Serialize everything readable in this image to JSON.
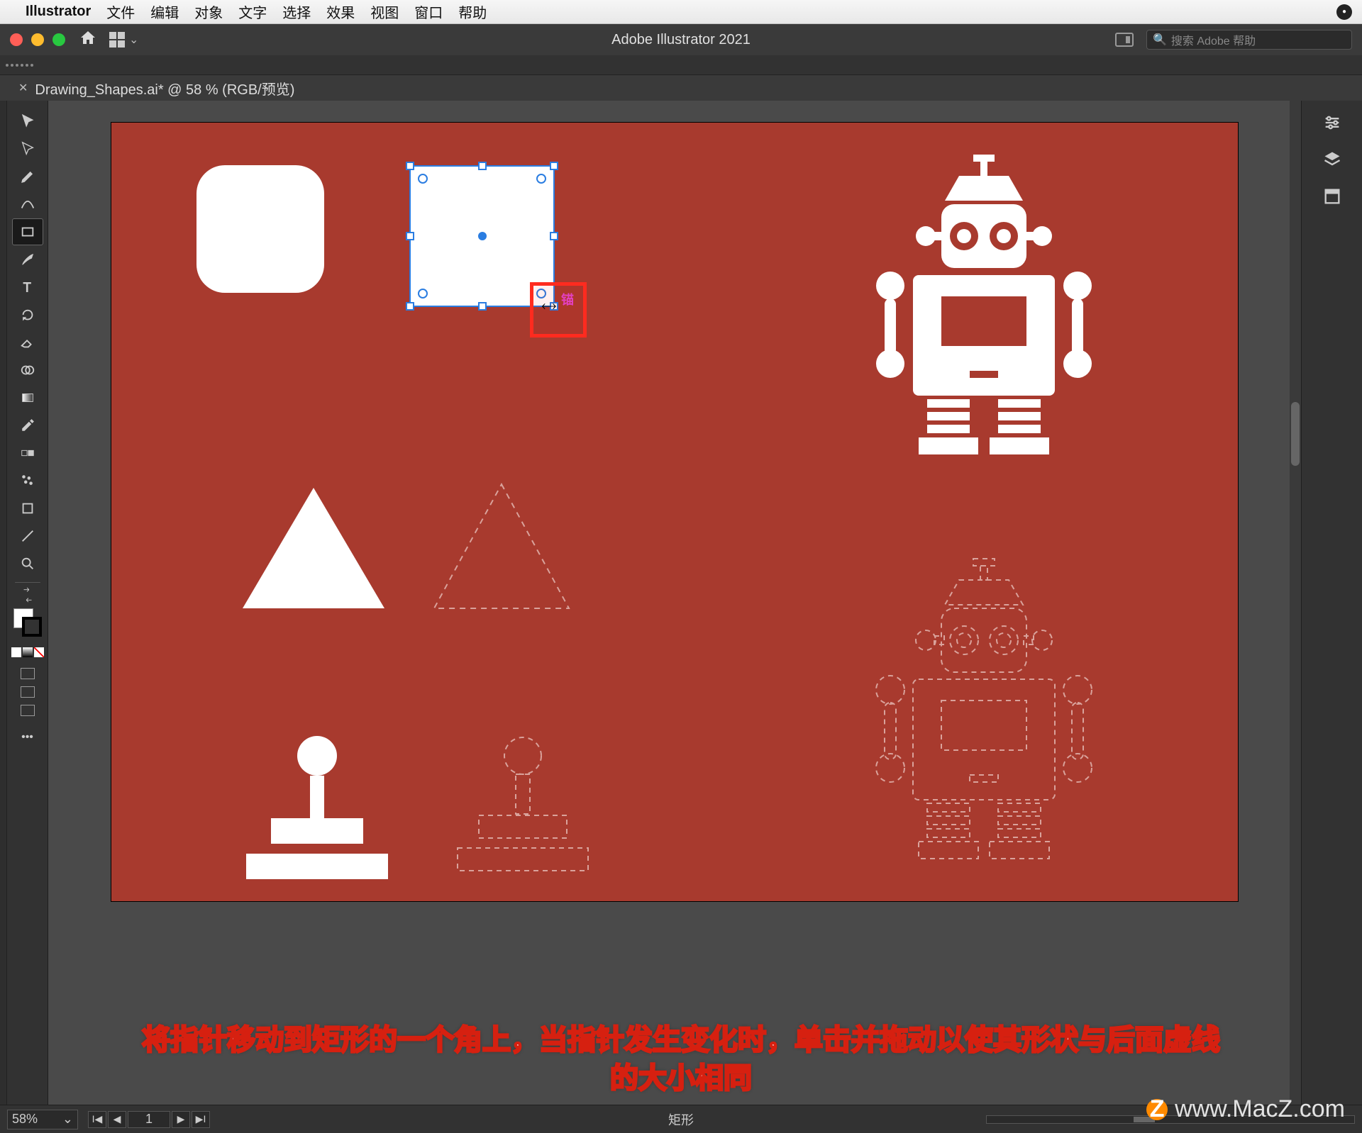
{
  "macos_menu": {
    "app_name": "Illustrator",
    "items": [
      "文件",
      "编辑",
      "对象",
      "文字",
      "选择",
      "效果",
      "视图",
      "窗口",
      "帮助"
    ]
  },
  "titlebar": {
    "app_title": "Adobe Illustrator 2021",
    "search_placeholder": "搜索 Adobe 帮助"
  },
  "document_tab": {
    "label": "Drawing_Shapes.ai* @ 58 % (RGB/预览)"
  },
  "tools": [
    "selection-tool",
    "direct-selection-tool",
    "pen-tool",
    "curvature-tool",
    "rectangle-tool",
    "paintbrush-tool",
    "type-tool",
    "rotate-tool",
    "eraser-tool",
    "shape-builder-tool",
    "gradient-tool",
    "eyedropper-tool",
    "blend-tool",
    "symbol-sprayer-tool",
    "artboard-tool",
    "slice-tool",
    "zoom-tool"
  ],
  "selected_tool_index": 4,
  "canvas": {
    "selection_tooltip": "锚",
    "shapes": {
      "rounded_square": "rounded-square-white",
      "selected_rectangle": "selected-rectangle-white",
      "triangle_solid": "triangle-white",
      "triangle_dashed": "triangle-dashed-outline",
      "joystick_solid": "joystick-white",
      "joystick_dashed": "joystick-dashed-outline",
      "robot_solid": "robot-white",
      "robot_dashed": "robot-dashed-outline"
    }
  },
  "right_panel_icons": [
    "properties-icon",
    "layers-icon",
    "libraries-icon"
  ],
  "status": {
    "zoom": "58%",
    "artboard_number": "1",
    "selection_type": "矩形"
  },
  "instruction": {
    "line1": "将指针移动到矩形的一个角上，当指针发生变化时，单击并拖动以使其形状与后面虚线",
    "line2": "的大小相同"
  },
  "watermark": "www.MacZ.com"
}
